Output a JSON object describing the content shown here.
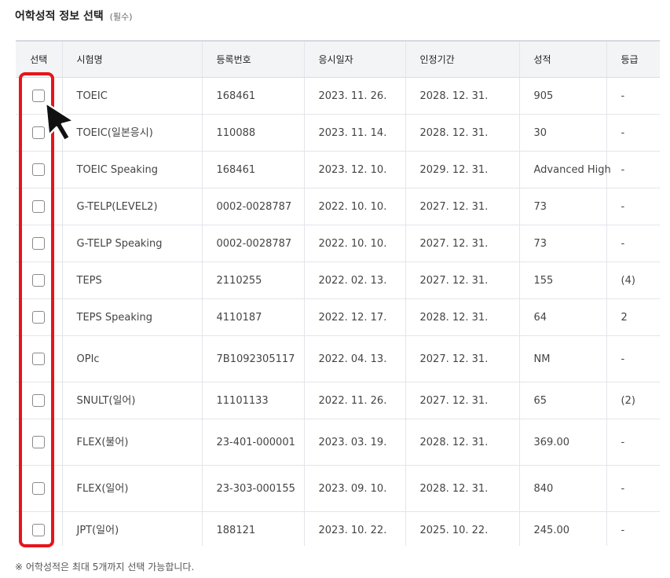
{
  "section": {
    "title": "어학성적 정보 선택",
    "required": "(필수)"
  },
  "columns": [
    "선택",
    "시험명",
    "등록번호",
    "응시일자",
    "인정기간",
    "성적",
    "등급"
  ],
  "rows": [
    {
      "exam": "TOEIC",
      "reg": "168461",
      "date": "2023. 11. 26.",
      "valid": "2028. 12. 31.",
      "score": "905",
      "grade": "-"
    },
    {
      "exam": "TOEIC(일본응시)",
      "reg": "110088",
      "date": "2023. 11. 14.",
      "valid": "2028. 12. 31.",
      "score": "30",
      "grade": "-"
    },
    {
      "exam": "TOEIC Speaking",
      "reg": "168461",
      "date": "2023. 12. 10.",
      "valid": "2029. 12. 31.",
      "score": "Advanced High",
      "grade": "-"
    },
    {
      "exam": "G-TELP(LEVEL2)",
      "reg": "0002-0028787",
      "date": "2022. 10. 10.",
      "valid": "2027. 12. 31.",
      "score": "73",
      "grade": "-"
    },
    {
      "exam": "G-TELP Speaking",
      "reg": "0002-0028787",
      "date": "2022. 10. 10.",
      "valid": "2027. 12. 31.",
      "score": "73",
      "grade": "-"
    },
    {
      "exam": "TEPS",
      "reg": "2110255",
      "date": "2022. 02. 13.",
      "valid": "2027. 12. 31.",
      "score": "155",
      "grade": "(4)"
    },
    {
      "exam": "TEPS Speaking",
      "reg": "4110187",
      "date": "2022. 12. 17.",
      "valid": "2028. 12. 31.",
      "score": "64",
      "grade": "2"
    },
    {
      "exam": "OPIc",
      "reg": "7B1092305117",
      "date": "2022. 04. 13.",
      "valid": "2027. 12. 31.",
      "score": "NM",
      "grade": "-"
    },
    {
      "exam": "SNULT(일어)",
      "reg": "11101133",
      "date": "2022. 11. 26.",
      "valid": "2027. 12. 31.",
      "score": "65",
      "grade": "(2)"
    },
    {
      "exam": "FLEX(불어)",
      "reg": "23-401-000001",
      "date": "2023. 03. 19.",
      "valid": "2028. 12. 31.",
      "score": "369.00",
      "grade": "-"
    },
    {
      "exam": "FLEX(일어)",
      "reg": "23-303-000155",
      "date": "2023. 09. 10.",
      "valid": "2028. 12. 31.",
      "score": "840",
      "grade": "-"
    },
    {
      "exam": "JPT(일어)",
      "reg": "188121",
      "date": "2023. 10. 22.",
      "valid": "2025. 10. 22.",
      "score": "245.00",
      "grade": "-"
    }
  ],
  "footnote": "※ 어학성적은 최대 5개까지 선택 가능합니다.",
  "colors": {
    "highlight": "#e8141b",
    "header_bg": "#f3f4f6"
  }
}
